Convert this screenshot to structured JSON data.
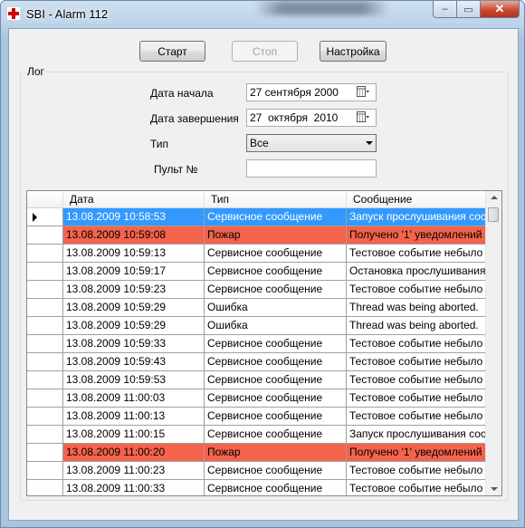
{
  "window": {
    "title": "SBI - Alarm 112",
    "min_glyph": "–",
    "max_glyph": "▭",
    "close_glyph": "✕",
    "icon": "red-cross-icon"
  },
  "toolbar": {
    "start": "Старт",
    "stop": "Стоп",
    "settings": "Настройка"
  },
  "log_group": {
    "label": "Лог"
  },
  "filters": {
    "start_date_label": "Дата начала",
    "start_date_value": "27 сентября 2000",
    "end_date_label": "Дата завершения",
    "end_date_value": "27  октября  2010",
    "type_label": "Тип",
    "type_value": "Все",
    "pult_label": "Пульт №",
    "pult_value": ""
  },
  "grid": {
    "columns": [
      "Дата",
      "Тип",
      "Сообщение"
    ],
    "rows": [
      [
        "13.08.2009 10:58:53",
        "Сервисное сообщение",
        "Запуск прослушивания соо..."
      ],
      [
        "13.08.2009 10:59:08",
        "Пожар",
        "Получено '1' уведомлений"
      ],
      [
        "13.08.2009 10:59:13",
        "Сервисное сообщение",
        "Тестовое событие небыло ..."
      ],
      [
        "13.08.2009 10:59:17",
        "Сервисное сообщение",
        "Остановка прослушивания"
      ],
      [
        "13.08.2009 10:59:23",
        "Сервисное сообщение",
        "Тестовое событие небыло ..."
      ],
      [
        "13.08.2009 10:59:29",
        "Ошибка",
        "Thread was being aborted."
      ],
      [
        "13.08.2009 10:59:29",
        "Ошибка",
        "Thread was being aborted."
      ],
      [
        "13.08.2009 10:59:33",
        "Сервисное сообщение",
        "Тестовое событие небыло ..."
      ],
      [
        "13.08.2009 10:59:43",
        "Сервисное сообщение",
        "Тестовое событие небыло ..."
      ],
      [
        "13.08.2009 10:59:53",
        "Сервисное сообщение",
        "Тестовое событие небыло ..."
      ],
      [
        "13.08.2009 11:00:03",
        "Сервисное сообщение",
        "Тестовое событие небыло ..."
      ],
      [
        "13.08.2009 11:00:13",
        "Сервисное сообщение",
        "Тестовое событие небыло ..."
      ],
      [
        "13.08.2009 11:00:15",
        "Сервисное сообщение",
        "Запуск прослушивания соо..."
      ],
      [
        "13.08.2009 11:00:20",
        "Пожар",
        "Получено '1' уведомлений"
      ],
      [
        "13.08.2009 11:00:23",
        "Сервисное сообщение",
        "Тестовое событие небыло ..."
      ],
      [
        "13.08.2009 11:00:33",
        "Сервисное сообщение",
        "Тестовое событие небыло ..."
      ]
    ],
    "selected_row": 0,
    "highlighted_rows": [
      1,
      13
    ]
  },
  "colors": {
    "selection": "#3399ff",
    "fire_highlight": "#f4634c"
  }
}
